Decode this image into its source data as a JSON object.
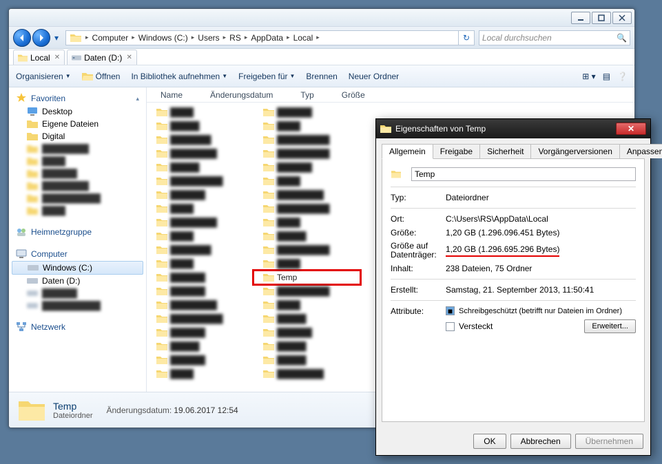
{
  "window": {
    "min": "–",
    "max": "▭",
    "close": "✕"
  },
  "breadcrumbs": [
    "Computer",
    "Windows (C:)",
    "Users",
    "RS",
    "AppData",
    "Local"
  ],
  "search": {
    "placeholder": "Local durchsuchen"
  },
  "tabs": [
    {
      "label": "Local"
    },
    {
      "label": "Daten (D:)"
    }
  ],
  "toolbar": {
    "organize": "Organisieren",
    "open": "Öffnen",
    "library": "In Bibliothek aufnehmen",
    "share": "Freigeben für",
    "burn": "Brennen",
    "newfolder": "Neuer Ordner"
  },
  "columns": {
    "name": "Name",
    "date": "Änderungsdatum",
    "type": "Typ",
    "size": "Größe"
  },
  "sidebar": {
    "fav": {
      "head": "Favoriten",
      "items": [
        "Desktop",
        "Eigene Dateien",
        "Digital"
      ]
    },
    "home": {
      "head": "Heimnetzgruppe"
    },
    "comp": {
      "head": "Computer",
      "items": [
        "Windows (C:)",
        "Daten (D:)"
      ]
    },
    "net": {
      "head": "Netzwerk"
    }
  },
  "files_blur": [
    " ",
    " ",
    " ",
    " ",
    " ",
    " ",
    " ",
    " ",
    " ",
    " ",
    " ",
    " ",
    " ",
    " ",
    " ",
    " ",
    " ",
    " ",
    " ",
    " ",
    " ",
    " ",
    " ",
    " ",
    " ",
    " ",
    " ",
    " ",
    " ",
    " ",
    " ",
    " ",
    " ",
    " ",
    " ",
    " ",
    " ",
    " ",
    " ",
    " "
  ],
  "temp_item": "Temp",
  "details": {
    "name": "Temp",
    "type": "Dateiordner",
    "date_label": "Änderungsdatum:",
    "date": "19.06.2017 12:54"
  },
  "props": {
    "title": "Eigenschaften von Temp",
    "tabs": [
      "Allgemein",
      "Freigabe",
      "Sicherheit",
      "Vorgängerversionen",
      "Anpassen"
    ],
    "name": "Temp",
    "rows": {
      "typ": {
        "l": "Typ:",
        "v": "Dateiordner"
      },
      "ort": {
        "l": "Ort:",
        "v": "C:\\Users\\RS\\AppData\\Local"
      },
      "groesse": {
        "l": "Größe:",
        "v": "1,20 GB (1.296.096.451 Bytes)"
      },
      "disk": {
        "l": "Größe auf Datenträger:",
        "v": "1,20 GB (1.296.695.296 Bytes)"
      },
      "inhalt": {
        "l": "Inhalt:",
        "v": "238 Dateien, 75 Ordner"
      },
      "erstellt": {
        "l": "Erstellt:",
        "v": "Samstag, 21. September 2013, 11:50:41"
      },
      "attr": {
        "l": "Attribute:",
        "ro": "Schreibgeschützt (betrifft nur Dateien im Ordner)",
        "hid": "Versteckt",
        "adv": "Erweitert..."
      }
    },
    "buttons": {
      "ok": "OK",
      "cancel": "Abbrechen",
      "apply": "Übernehmen"
    }
  }
}
